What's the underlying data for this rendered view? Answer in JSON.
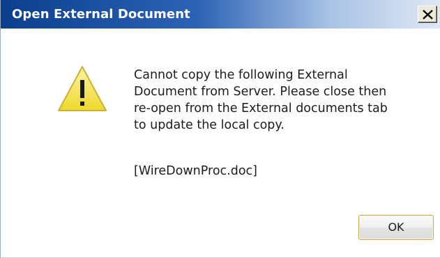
{
  "dialog": {
    "title": "Open External Document",
    "close_label": "X",
    "icon": "warning-icon",
    "message_lines": [
      "Cannot copy the following External",
      "Document from Server. Please close then",
      "re-open from the External documents tab",
      "to update the local copy."
    ],
    "filename": "[WireDownProc.doc]",
    "ok_label": "OK"
  },
  "colors": {
    "titlebar_start": "#0b3f8e",
    "titlebar_end": "#dfe8f4",
    "warning_fill": "#f7e84a",
    "ok_border": "#d8a14a"
  }
}
